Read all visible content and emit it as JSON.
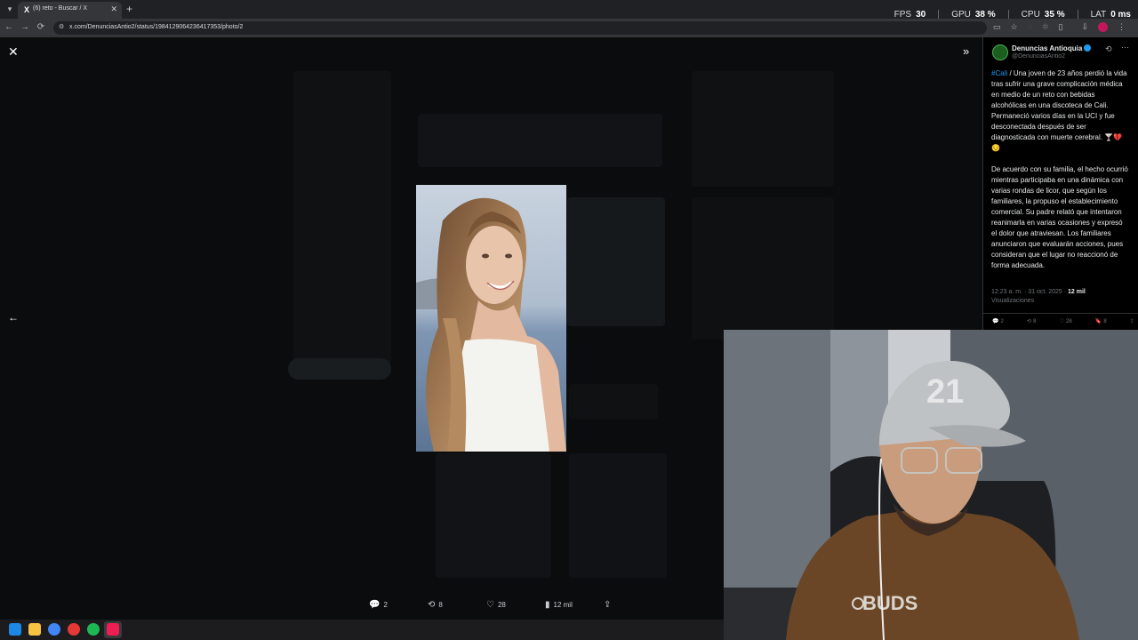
{
  "browser": {
    "tab_title": "(6) reto - Buscar / X",
    "tab_favicon": "X",
    "url": "x.com/DenunciasAntio2/status/1984129064236417353/photo/2"
  },
  "overlay_stats": [
    {
      "label": "FPS",
      "value": "30"
    },
    {
      "label": "GPU",
      "value": "38 %"
    },
    {
      "label": "CPU",
      "value": "35 %"
    },
    {
      "label": "LAT",
      "value": "0 ms"
    }
  ],
  "viewer": {
    "photo_alt": "Young woman in white top smiling at sea backdrop",
    "actions": [
      {
        "icon": "reply-icon",
        "glyph": "💬",
        "count": "2"
      },
      {
        "icon": "retweet-icon",
        "glyph": "⟲",
        "count": "8"
      },
      {
        "icon": "like-icon",
        "glyph": "♡",
        "count": "28"
      },
      {
        "icon": "views-icon",
        "glyph": "▮",
        "count": "12 mil"
      },
      {
        "icon": "share-icon",
        "glyph": "⇪",
        "count": ""
      }
    ]
  },
  "panel": {
    "author_name": "Denuncias Antioquia",
    "author_handle": "@DenunciasAntio2",
    "hashtag": "#Cali",
    "paragraph1": " / Una joven de 23 años perdió la vida tras sufrir una grave complicación médica en medio de un reto con bebidas alcohólicas en una discoteca de Cali. Permaneció varios días en la UCI y fue desconectada después de ser diagnosticada con muerte cerebral. 🍸💔😔",
    "paragraph2": "De acuerdo con su familia, el hecho ocurrió mientras participaba en una dinámica con varias rondas de licor, que según los familiares, la propuso el establecimiento comercial. Su padre relató que intentaron reanimarla en varias ocasiones y expresó el dolor que atraviesan. Los familiares anunciaron que evaluarán acciones, pues consideran que el lugar no reaccionó de forma adecuada.",
    "timestamp": "12:23 a. m. · 31 oct. 2025 · ",
    "views_count": "12 mil",
    "views_label": "Visualizaciones",
    "actions": [
      {
        "icon": "reply-icon",
        "glyph": "💬",
        "count": "2"
      },
      {
        "icon": "retweet-icon",
        "glyph": "⟲",
        "count": "8"
      },
      {
        "icon": "like-icon",
        "glyph": "♡",
        "count": "28"
      },
      {
        "icon": "bookmark-icon",
        "glyph": "🔖",
        "count": "8"
      },
      {
        "icon": "share-icon",
        "glyph": "⇪",
        "count": ""
      }
    ]
  },
  "webcam": {
    "cap_text": "21",
    "shirt_text": "BUDS"
  }
}
